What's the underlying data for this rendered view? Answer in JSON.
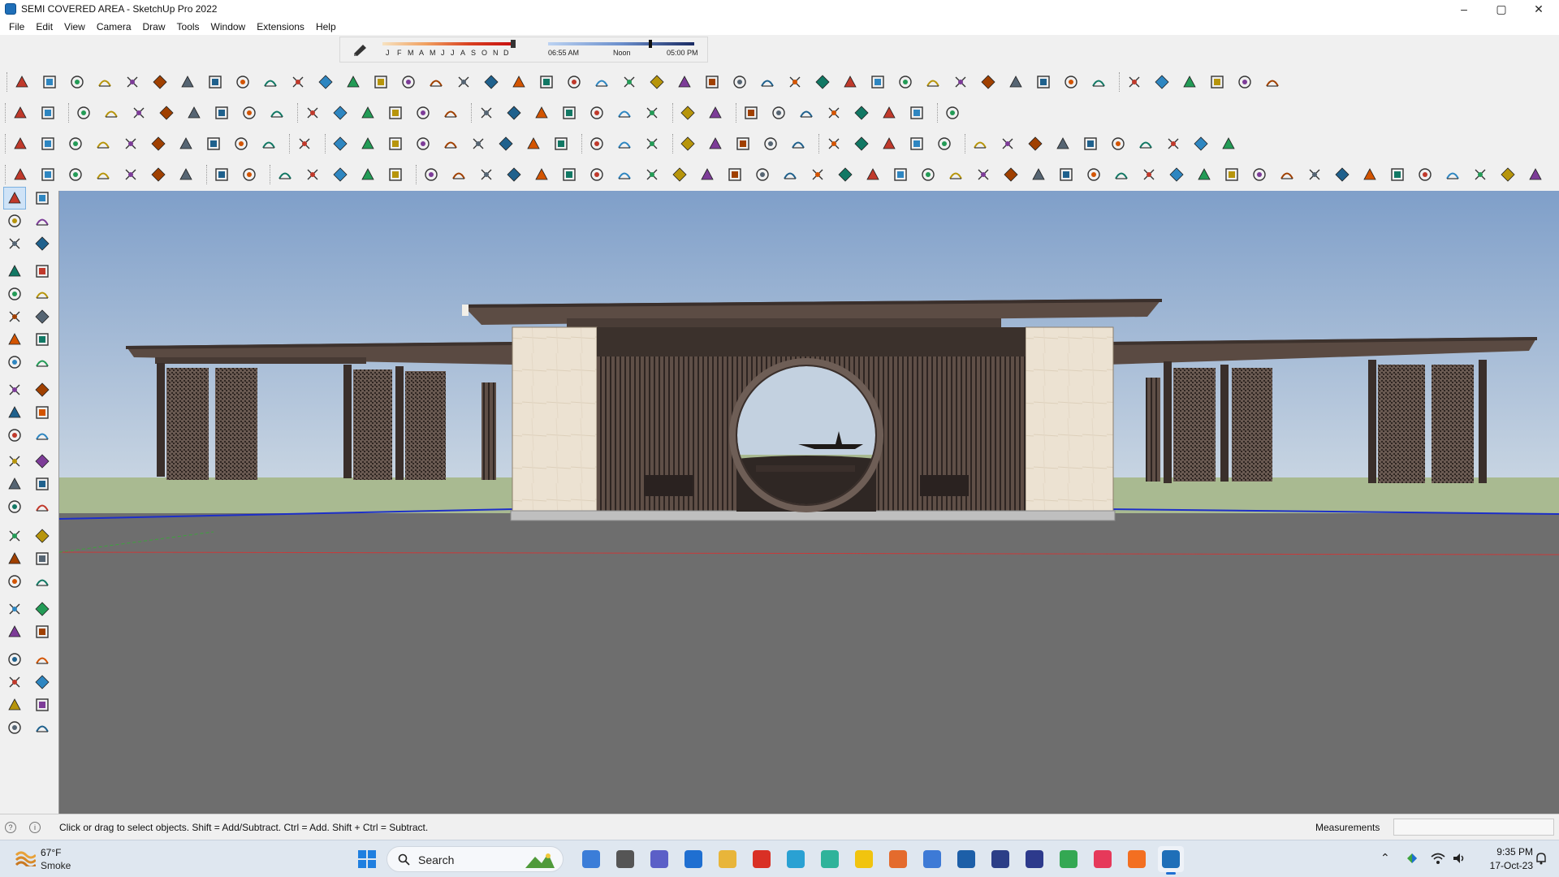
{
  "window": {
    "title": "SEMI COVERED AREA - SketchUp Pro 2022",
    "minimize": "–",
    "maximize": "▢",
    "close": "✕"
  },
  "menu": [
    "File",
    "Edit",
    "View",
    "Camera",
    "Draw",
    "Tools",
    "Window",
    "Extensions",
    "Help"
  ],
  "shadows": {
    "months": [
      "J",
      "F",
      "M",
      "A",
      "M",
      "J",
      "J",
      "A",
      "S",
      "O",
      "N",
      "D"
    ],
    "time_start": "06:55 AM",
    "time_mid": "Noon",
    "time_end": "05:00 PM"
  },
  "status": {
    "hint": "Click or drag to select objects. Shift = Add/Subtract. Ctrl = Add. Shift + Ctrl = Subtract.",
    "measurements_label": "Measurements",
    "measurements_value": ""
  },
  "taskbar": {
    "weather_temp": "67°F",
    "weather_desc": "Smoke",
    "search_label": "Search",
    "clock_time": "9:35 PM",
    "clock_date": "17-Oct-23"
  },
  "colors": {
    "sky_top": "#7f9fc9",
    "sky_bottom": "#c7d4e2",
    "ground": "#6e6e6e",
    "grass": "#a9ba91",
    "timber": "#5a4a42",
    "stone": "#ece2d2",
    "accent": "#1f6fd1"
  }
}
